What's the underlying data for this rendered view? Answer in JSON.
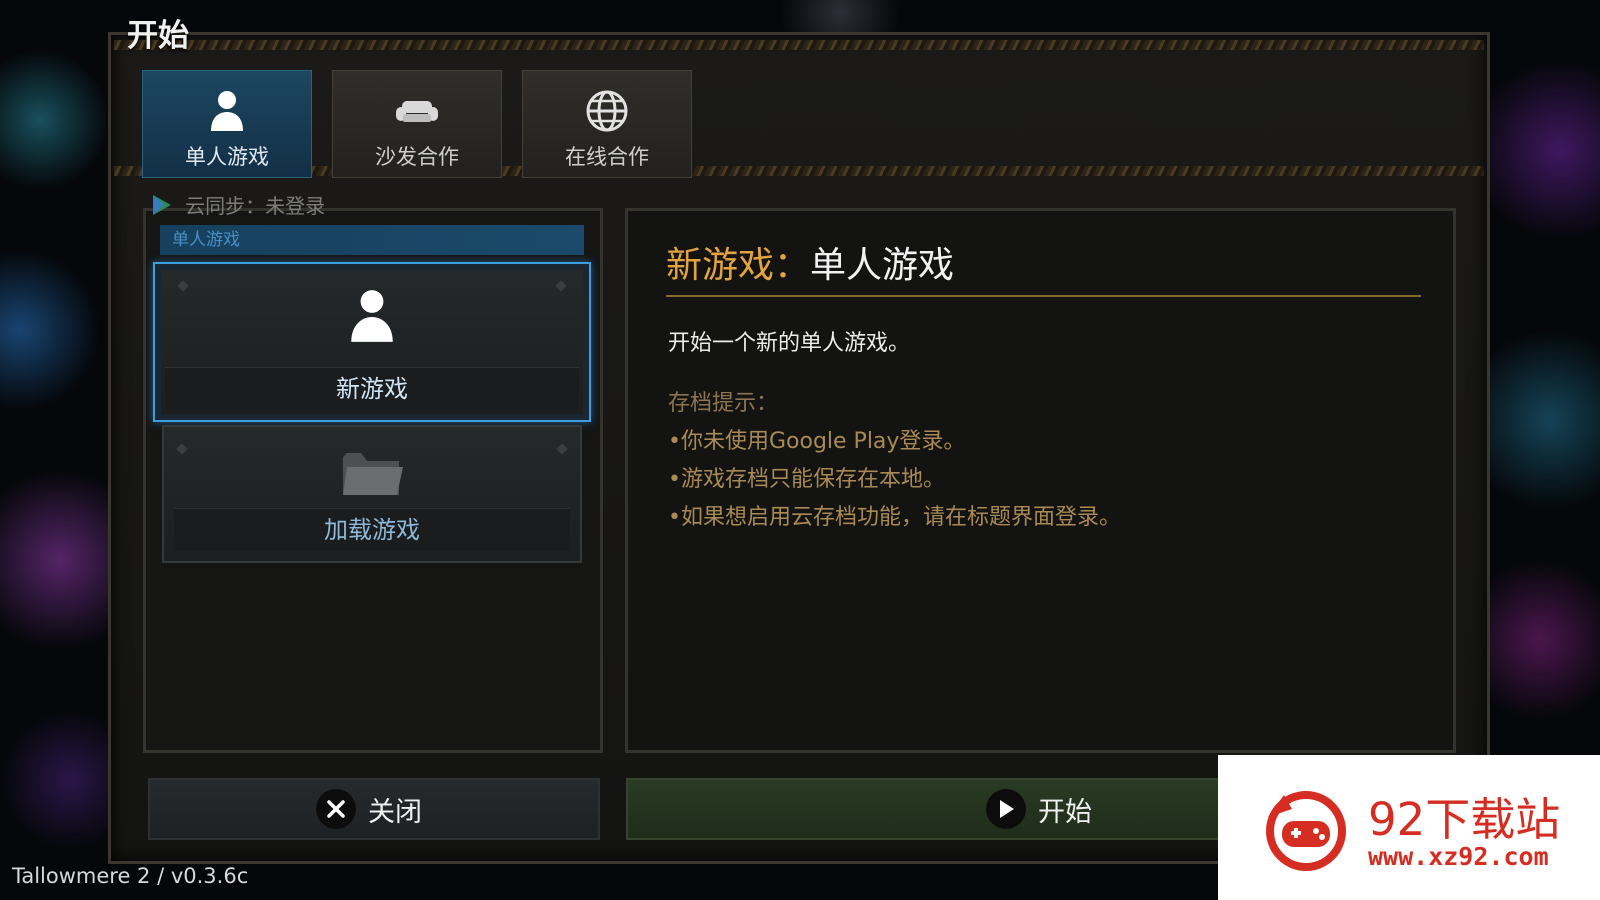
{
  "page": {
    "title": "开始"
  },
  "tabs": [
    {
      "label": "单人游戏",
      "icon": "single-player-icon",
      "active": true
    },
    {
      "label": "沙发合作",
      "icon": "sofa-icon",
      "active": false
    },
    {
      "label": "在线合作",
      "icon": "globe-icon",
      "active": false
    }
  ],
  "left_panel": {
    "sync_status": "云同步：未登录",
    "section_header": "单人游戏",
    "options": [
      {
        "label": "新游戏",
        "icon": "person-icon",
        "selected": true
      },
      {
        "label": "加载游戏",
        "icon": "folder-icon",
        "selected": false
      }
    ]
  },
  "detail": {
    "title_prefix": "新游戏：",
    "title_main": "单人游戏",
    "description": "开始一个新的单人游戏。",
    "hint_title": "存档提示：",
    "hints": [
      "•你未使用Google Play登录。",
      "•游戏存档只能保存在本地。",
      "•如果想启用云存档功能，请在标题界面登录。"
    ]
  },
  "buttons": {
    "close_label": "关闭",
    "start_label": "开始"
  },
  "footer": {
    "version": "Tallowmere 2 / v0.3.6c"
  },
  "watermark": {
    "name": "92下载站",
    "url": "www.xz92.com"
  },
  "colors": {
    "accent_blue": "#3d9ee0",
    "title_gold": "#e1a43f",
    "hint_gold": "#a98a55",
    "brand_red": "#d62d22"
  }
}
